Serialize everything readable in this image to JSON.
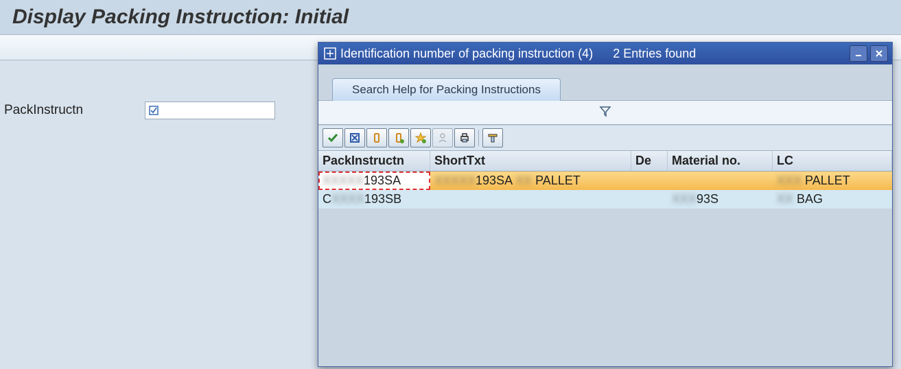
{
  "page": {
    "title": "Display Packing Instruction: Initial",
    "field_label": "PackInstructn"
  },
  "dialog": {
    "title": "Identification number of packing instruction (4)",
    "entries_found": "2 Entries found",
    "tab_label": "Search Help for Packing Instructions",
    "columns": {
      "c1": "PackInstructn",
      "c2": "ShortTxt",
      "c3": "De",
      "c4": "Material no.",
      "c5": "LC"
    },
    "rows": [
      {
        "selected": true,
        "pack": "193SA",
        "short": "193SA",
        "short_suffix": "PALLET",
        "material": "",
        "lc": "PALLET"
      },
      {
        "selected": false,
        "pack": "193SB",
        "short": "",
        "short_suffix": "",
        "material": "93S",
        "lc": "BAG"
      }
    ]
  }
}
